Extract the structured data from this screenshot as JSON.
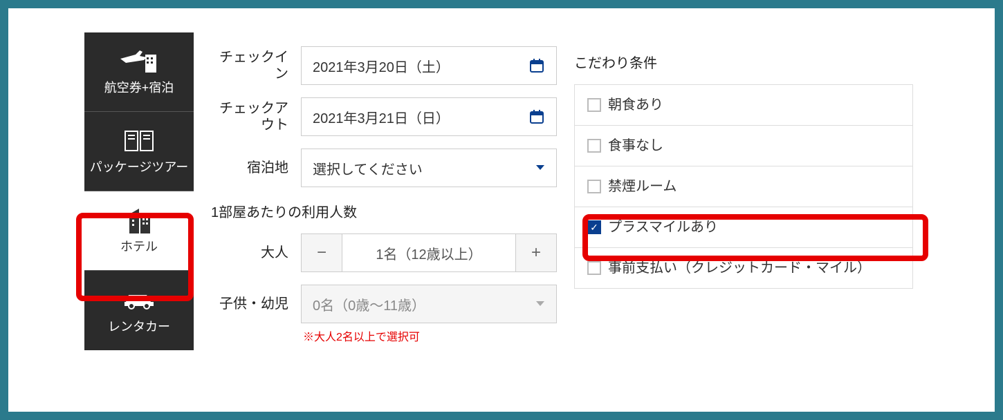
{
  "sidebar": {
    "items": [
      {
        "label": "航空券+宿泊",
        "icon": "plane-building-icon"
      },
      {
        "label": "パッケージツアー",
        "icon": "brochure-icon"
      },
      {
        "label": "ホテル",
        "icon": "building-icon"
      },
      {
        "label": "レンタカー",
        "icon": "car-icon"
      }
    ],
    "active_index": 2
  },
  "form": {
    "checkin_label": "チェックイン",
    "checkin_value": "2021年3月20日（土）",
    "checkout_label": "チェックアウト",
    "checkout_value": "2021年3月21日（日）",
    "destination_label": "宿泊地",
    "destination_placeholder": "選択してください",
    "room_section_label": "1部屋あたりの利用人数",
    "adult_label": "大人",
    "adult_value": "1名（12歳以上）",
    "child_label": "子供・幼児",
    "child_value": "0名（0歳～11歳）",
    "child_note": "※大人2名以上で選択可"
  },
  "filters": {
    "title": "こだわり条件",
    "items": [
      {
        "label": "朝食あり",
        "checked": false
      },
      {
        "label": "食事なし",
        "checked": false
      },
      {
        "label": "禁煙ルーム",
        "checked": false
      },
      {
        "label": "プラスマイルあり",
        "checked": true
      },
      {
        "label": "事前支払い（クレジットカード・マイル）",
        "checked": false
      }
    ]
  },
  "icons": {
    "minus": "−",
    "plus": "+",
    "check": "✓"
  }
}
